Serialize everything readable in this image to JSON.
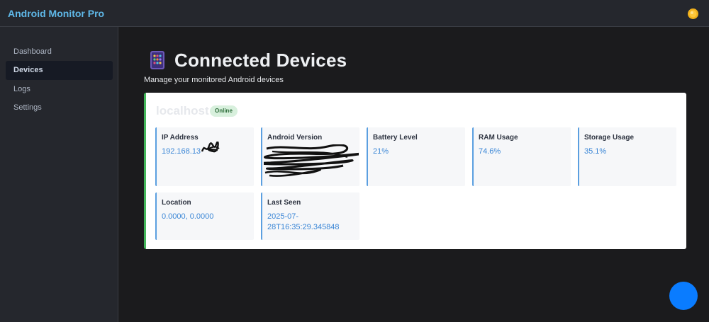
{
  "app": {
    "title": "Android Monitor Pro"
  },
  "sidebar": {
    "items": [
      {
        "label": "Dashboard",
        "active": false
      },
      {
        "label": "Devices",
        "active": true
      },
      {
        "label": "Logs",
        "active": false
      },
      {
        "label": "Settings",
        "active": false
      }
    ]
  },
  "page": {
    "title": "Connected Devices",
    "subtitle": "Manage your monitored Android devices"
  },
  "device": {
    "name": "localhost",
    "status": "Online",
    "stats": [
      {
        "label": "IP Address",
        "value": "192.168.13"
      },
      {
        "label": "Android Version",
        "value": ""
      },
      {
        "label": "Battery Level",
        "value": "21%"
      },
      {
        "label": "RAM Usage",
        "value": "74.6%"
      },
      {
        "label": "Storage Usage",
        "value": "35.1%"
      },
      {
        "label": "Location",
        "value": "0.0000, 0.0000"
      },
      {
        "label": "Last Seen",
        "value": "2025-07-28T16:35:29.345848"
      }
    ]
  },
  "icons": {
    "theme_toggle": "sun-icon",
    "page_icon": "phone-icon",
    "fab": "circle-action-icon"
  },
  "colors": {
    "accent": "#5fb8e8",
    "online": "#43b65a",
    "value": "#3a86d6",
    "fab": "#0a7cff"
  }
}
